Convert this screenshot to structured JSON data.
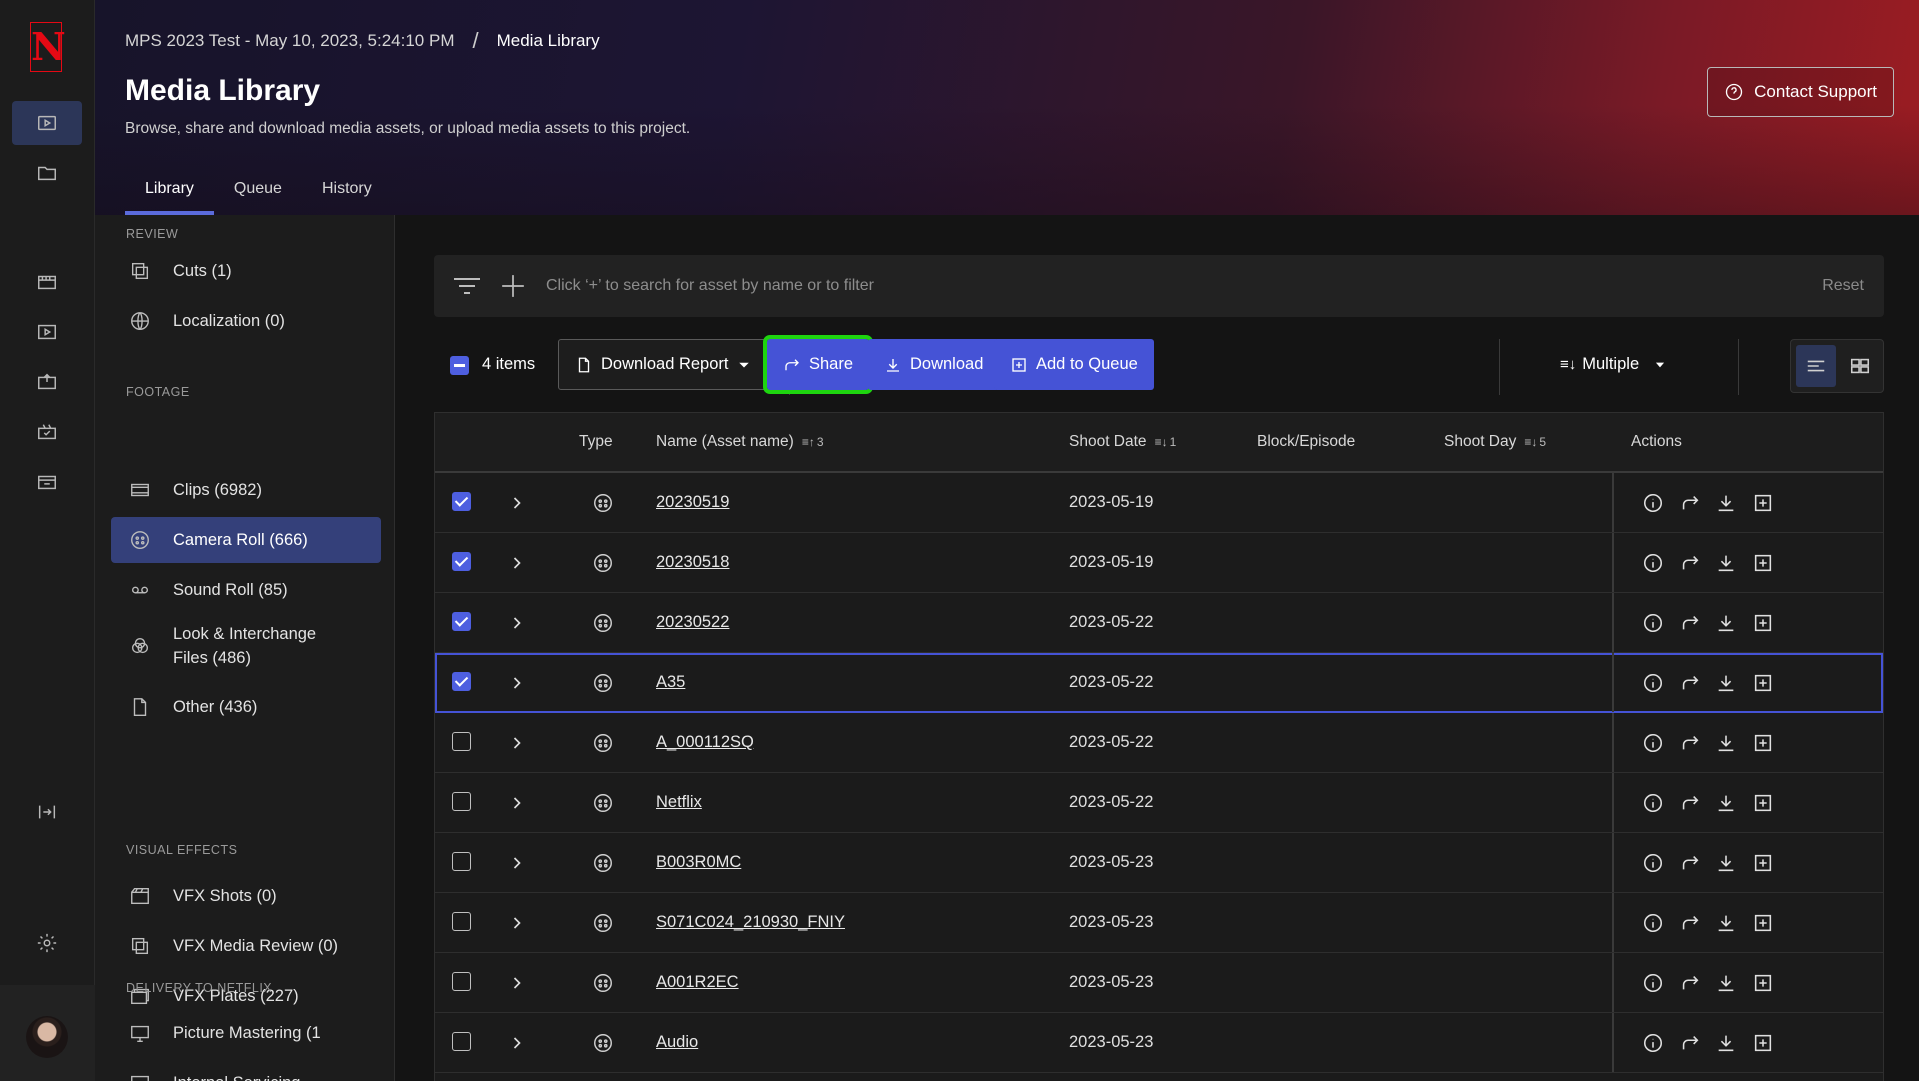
{
  "app": {
    "logo_text": "N"
  },
  "breadcrumb": {
    "project": "MPS 2023 Test - May 10, 2023, 5:24:10 PM",
    "separator": "/",
    "current": "Media Library"
  },
  "page": {
    "title": "Media Library",
    "subtitle": "Browse, share and download media assets, or upload media assets to this project."
  },
  "contact_support": "Contact Support",
  "tabs": [
    {
      "label": "Library",
      "active": true
    },
    {
      "label": "Queue"
    },
    {
      "label": "History"
    }
  ],
  "sidebar": {
    "sections": {
      "review": "REVIEW",
      "footage": "FOOTAGE",
      "vfx": "VISUAL EFFECTS",
      "delivery": "DELIVERY TO NETFLIX"
    },
    "items": {
      "cuts": "Cuts (1)",
      "localization": "Localization (0)",
      "clips": "Clips (6982)",
      "camera_roll": "Camera Roll (666)",
      "sound_roll": "Sound Roll (85)",
      "look_line1": "Look & Interchange",
      "look_line2": "Files (486)",
      "other": "Other (436)",
      "vfx_shots": "VFX Shots (0)",
      "vfx_media_review": "VFX Media Review (0)",
      "vfx_plates": "VFX Plates (227)",
      "picture_mastering": "Picture Mastering (1",
      "internal_servicing": "Internal Servicing"
    }
  },
  "search": {
    "placeholder": "Click ‘+’ to search for asset by name or to filter",
    "reset": "Reset"
  },
  "toolbar": {
    "selected_count": "4 items",
    "download_report": "Download Report",
    "share": "Share",
    "download": "Download",
    "add_to_queue": "Add to Queue",
    "sort": "Multiple"
  },
  "table": {
    "headers": {
      "type": "Type",
      "name": "Name (Asset name)",
      "name_sort": "3",
      "shoot_date": "Shoot Date",
      "shoot_date_sort": "1",
      "block": "Block/Episode",
      "shoot_day": "Shoot Day",
      "shoot_day_sort": "5",
      "actions": "Actions"
    },
    "rows": [
      {
        "name": "20230519",
        "shoot_date": "2023-05-19",
        "checked": true
      },
      {
        "name": "20230518",
        "shoot_date": "2023-05-19",
        "checked": true
      },
      {
        "name": "20230522",
        "shoot_date": "2023-05-22",
        "checked": true
      },
      {
        "name": "A35",
        "shoot_date": "2023-05-22",
        "checked": true,
        "focused": true
      },
      {
        "name": "A_000112SQ",
        "shoot_date": "2023-05-22",
        "checked": false
      },
      {
        "name": "Netflix",
        "shoot_date": "2023-05-22",
        "checked": false
      },
      {
        "name": "B003R0MC",
        "shoot_date": "2023-05-23",
        "checked": false
      },
      {
        "name": "S071C024_210930_FNIY",
        "shoot_date": "2023-05-23",
        "checked": false
      },
      {
        "name": "A001R2EC",
        "shoot_date": "2023-05-23",
        "checked": false
      },
      {
        "name": "Audio",
        "shoot_date": "2023-05-23",
        "checked": false
      }
    ]
  },
  "colors": {
    "accent": "#4553d6",
    "highlight_outline": "#1ed40f",
    "brand": "#e50914"
  }
}
